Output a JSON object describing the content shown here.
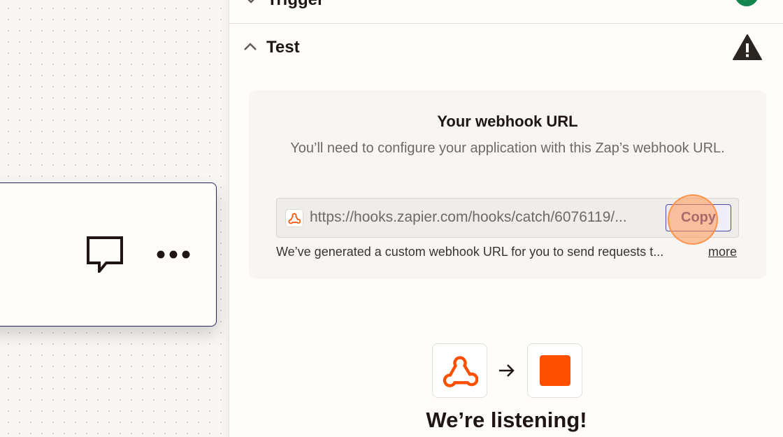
{
  "canvas": {
    "step_card": {
      "comment_icon": "comment-icon",
      "more_icon": "more-horizontal-icon"
    }
  },
  "panel": {
    "trigger_section": {
      "label": "Trigger",
      "status_icon": "check-circle-icon",
      "status_color": "#13854e"
    },
    "test_section": {
      "label": "Test",
      "status_icon": "warning-icon",
      "expanded": true
    },
    "webhook": {
      "title": "Your webhook URL",
      "description": "You’ll need to configure your application with this Zap’s webhook URL.",
      "url": "https://hooks.zapier.com/hooks/catch/6076119/...",
      "copy_label": "Copy",
      "note": "We’ve generated a custom webhook URL for you to send requests t...",
      "more_label": "more"
    },
    "listening": {
      "source_icon": "webhook-icon",
      "arrow_icon": "arrow-right-icon",
      "target_icon": "zapier-square-icon",
      "message": "We’re listening!"
    }
  },
  "colors": {
    "accent_orange": "#ff4f00",
    "copy_button_border": "#4b4aa8",
    "success_green": "#13854e"
  }
}
